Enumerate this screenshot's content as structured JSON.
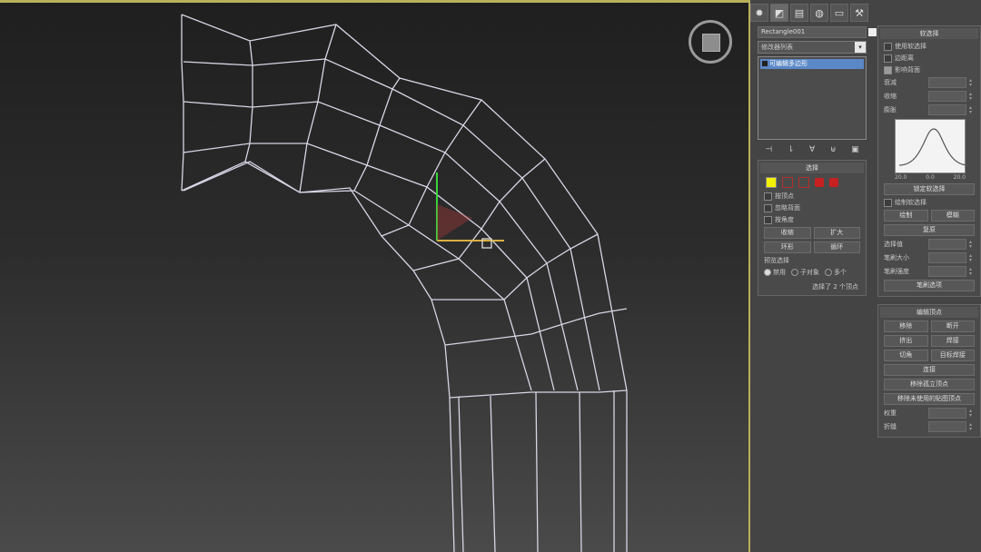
{
  "viewport": {
    "name": "3d-viewport"
  },
  "panel": {
    "tabs": [
      "create-icon",
      "modify-icon",
      "hierarchy-icon",
      "motion-icon",
      "display-icon",
      "utilities-icon"
    ],
    "tab_glyphs": [
      "✹",
      "◩",
      "▤",
      "◍",
      "▭",
      "⚒"
    ],
    "object_name": "Rectangle001",
    "modifier_list": "修改器列表",
    "stack_item": "可编辑多边形",
    "stack_icons": [
      "⊣",
      "⇂",
      "∀",
      "⊎",
      "▣"
    ],
    "selection": {
      "title": "选择",
      "by_vertex": "按顶点",
      "ignore_backfacing": "忽略背面",
      "by_angle": "按角度",
      "shrink": "收缩",
      "grow": "扩大",
      "ring": "环形",
      "loop": "循环",
      "preview_title": "预览选择",
      "preview_options": [
        "禁用",
        "子对象",
        "多个"
      ],
      "status": "选择了 2 个顶点"
    },
    "soft_selection": {
      "title": "软选择",
      "use_soft": "使用软选择",
      "edge_distance": "边距离",
      "affect_backfacing": "影响背面",
      "falloff": "衰减",
      "pinch": "收缩",
      "bubble": "膨胀",
      "graph_ticks": [
        "20.0",
        "0.0",
        "20.0"
      ],
      "lock_soft": "锁定软选择",
      "paint_soft": "绘制软选择",
      "paint": "绘制",
      "blur": "模糊",
      "revert": "复原",
      "selection_value": "选择值",
      "brush_size": "笔刷大小",
      "brush_strength": "笔刷强度",
      "brush_options": "笔刷选项"
    },
    "edit_vertices": {
      "title": "编辑顶点",
      "remove": "移除",
      "break": "断开",
      "extrude": "挤出",
      "weld": "焊接",
      "chamfer": "切角",
      "target_weld": "目标焊接",
      "connect": "连接",
      "remove_isolated": "移除孤立顶点",
      "remove_unused_map": "移除未使用的贴图顶点",
      "weight": "权重",
      "crease": "折缝"
    }
  }
}
